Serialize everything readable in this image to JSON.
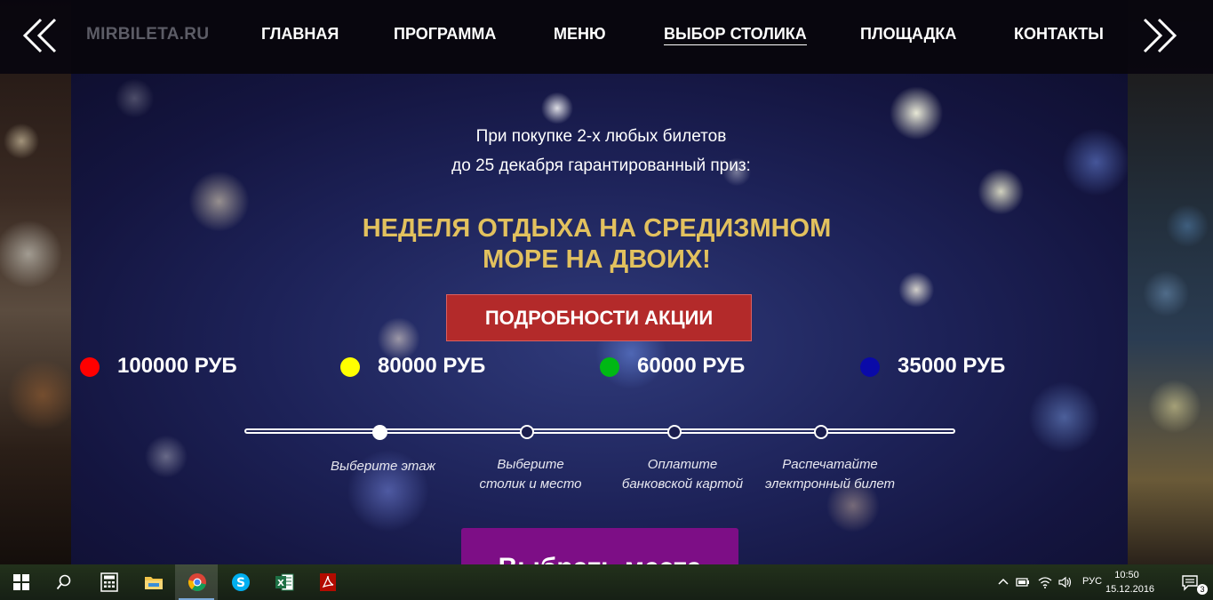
{
  "site": {
    "logo": "MIRBILETA.RU",
    "nav": [
      {
        "label": "ГЛАВНАЯ"
      },
      {
        "label": "ПРОГРАММА"
      },
      {
        "label": "МЕНЮ"
      },
      {
        "label": "ВЫБОР СТОЛИКА",
        "active": true
      },
      {
        "label": "ПЛОЩАДКА"
      },
      {
        "label": "КОНТАКТЫ"
      }
    ],
    "prev_icon": "double-chevron-left-icon",
    "next_icon": "double-chevron-right-icon"
  },
  "promo": {
    "line1": "При покупке 2-х любых билетов",
    "line2": "до 25 декабря гарантированный приз:",
    "headline_line1": "НЕДЕЛЯ ОТДЫХА НА СРЕДИЗМНОМ",
    "headline_line2": "МОРЕ НА ДВОИХ!",
    "details_button": "ПОДРОБНОСТИ АКЦИИ"
  },
  "prices": [
    {
      "label": "100000 РУБ",
      "color": "#ff0000"
    },
    {
      "label": "80000 РУБ",
      "color": "#ffff00"
    },
    {
      "label": "60000 РУБ",
      "color": "#00b814"
    },
    {
      "label": "35000 РУБ",
      "color": "#0a0aa8"
    }
  ],
  "steps": [
    {
      "line1": "Выберите этаж",
      "line2": "",
      "active": true
    },
    {
      "line1": "Выберите",
      "line2": "столик и место",
      "active": false
    },
    {
      "line1": "Оплатите",
      "line2": "банковской картой",
      "active": false
    },
    {
      "line1": "Распечатайте",
      "line2": "электронный билет",
      "active": false
    }
  ],
  "choose_button": "Выбрать места",
  "colors": {
    "headline": "#e2c15e",
    "details_button": "#b32a2a",
    "choose_button": "#7d0e86"
  },
  "taskbar": {
    "apps": [
      {
        "name": "calculator",
        "icon": "calculator-icon"
      },
      {
        "name": "file-explorer",
        "icon": "folder-icon"
      },
      {
        "name": "chrome",
        "icon": "chrome-icon",
        "active": true
      },
      {
        "name": "skype",
        "icon": "skype-icon"
      },
      {
        "name": "excel",
        "icon": "excel-icon"
      },
      {
        "name": "acrobat",
        "icon": "pdf-icon"
      }
    ],
    "language": "РУС",
    "time": "10:50",
    "date": "15.12.2016",
    "notification_count": "3"
  }
}
